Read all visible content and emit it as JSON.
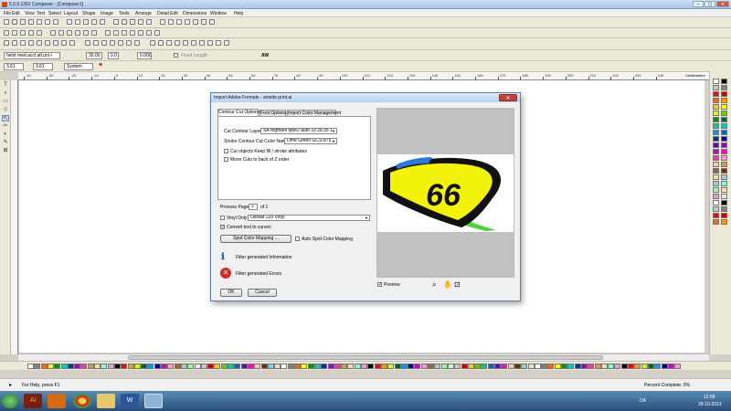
{
  "window": {
    "title": "5.0.0.1352 Composer - [Composer1]"
  },
  "menu": [
    "File",
    "Edit",
    "View",
    "Text",
    "Select",
    "Layout",
    "Shape",
    "Image",
    "Tools",
    "Arrange",
    "Detail Edit",
    "Dimensions",
    "Window",
    "Help"
  ],
  "toolbar": {
    "font_value": "helvt med.acct alt.uni-i",
    "size_value": "30.00",
    "kern_value": "0.0",
    "spacing_value": "0.000",
    "fixed_length_label": "Fixed Length",
    "aw_label": "AW",
    "width_value": "3.61",
    "height_value": "3.61",
    "units_value": "System"
  },
  "ruler": {
    "ticks": [
      "-40",
      "-30",
      "-20",
      "-10",
      "0",
      "10",
      "20",
      "30",
      "40",
      "50",
      "60",
      "70",
      "80",
      "90",
      "100",
      "110",
      "120",
      "130",
      "140",
      "150",
      "160",
      "170",
      "180",
      "190",
      "200",
      "210",
      "220",
      "230",
      "240"
    ],
    "units_label": "Centimeters"
  },
  "dialog": {
    "title": "Import Adobe Formats - streide print.ai",
    "tabs": [
      "Contour Cut Options",
      "Font Options",
      "Import Color Management"
    ],
    "cut_contour_layer_label": "Cut Contour Layer",
    "cut_contour_layer_value": "SA regmark type2 auto 33 28.35 1",
    "stroke_color_label": "Stroke Contour Cut Color Name",
    "stroke_color_value": "Lime Green GCS-876",
    "keep_fill_label": "Cut objects Keep fill / stroke attributes",
    "move_cuts_label": "Move Cuts to back of Z order",
    "process_page_label": "Process Page",
    "process_page_value": "1",
    "process_page_of": "of 1",
    "vinyl_only_label": "Vinyl Only",
    "vinyl_value": "Oerbar 220 Vinyl",
    "convert_text_label": "Convert text to curves",
    "spot_color_button": "Spot Color Mapping ...",
    "auto_spot_label": "Auto Spot Color Mapping",
    "info_message": "Filter generated Information",
    "error_message": "Filter generated Errors",
    "ok_button": "OK",
    "cancel_button": "Cancel",
    "preview_label": "Preview",
    "preview_number": "66",
    "close_glyph": "✕"
  },
  "status": {
    "help_text": "For Help, press F1",
    "percent_text": "Percent Complete: 0%"
  },
  "taskbar": {
    "language": "DA",
    "time": "12:58",
    "date": "28-10-2013"
  },
  "colors": {
    "accent": "#3a6ea5",
    "decal_yellow": "#f2f20a",
    "decal_green": "#4fd13a"
  }
}
